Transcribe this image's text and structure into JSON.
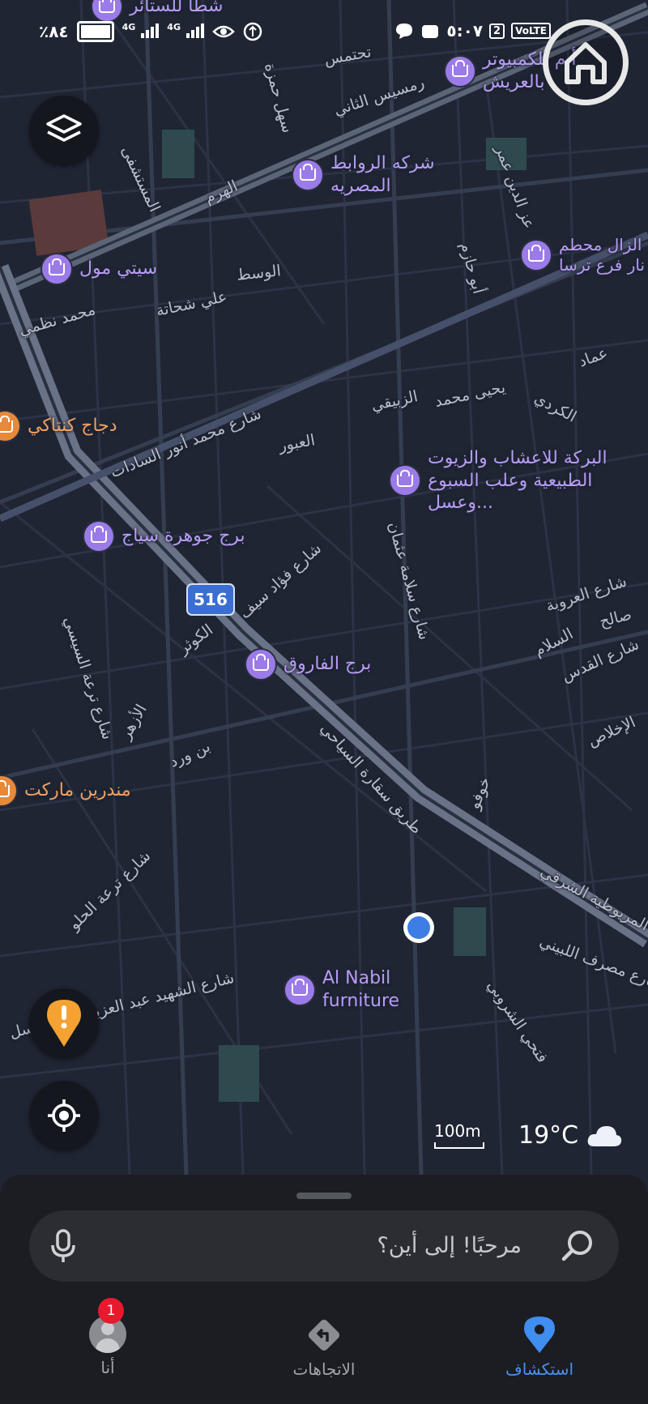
{
  "status_bar": {
    "battery_percent": "٪٨٤",
    "network_1": "4G",
    "network_2": "4G",
    "time": "٥:٠٧",
    "sim_badge": "2",
    "volte_label": "VoLTE"
  },
  "map": {
    "highway_shield": "516",
    "street_labels": [
      "تحتمس",
      "رمسيس الثاني",
      "سهل حمزة",
      "الهرم",
      "المستشفى",
      "الوسط",
      "علي شحاتة",
      "محمد نظمي",
      "أبو حازم",
      "عز الدين عمر",
      "عماد",
      "يحيى محمد",
      "الزبيقي",
      "الكردي",
      "شارع محمد أنور السادات",
      "العبور",
      "شارع فؤاد سيف",
      "شارع سلامة عثمان",
      "شارع العروبة",
      "صالح",
      "السلام",
      "شارع القدس",
      "الكوثر",
      "شارع ترعة السيسي",
      "الأزهر",
      "بن ورد",
      "طريق سقارة السياحي",
      "خوفو",
      "الإخلاص",
      "شارع ترعة الحلو",
      "المريوطية الشرقي",
      "شارع مصرف اللبيني",
      "شارع الشهيد عبد العزيز على الباسل",
      "فتحي الشروبي"
    ],
    "pois": [
      {
        "name": "شطا للستائر",
        "color": "purple"
      },
      {
        "name": "أ.م للكمبيوتر بالعريش",
        "color": "purple"
      },
      {
        "name": "شركه الروابط المصريه",
        "color": "purple"
      },
      {
        "name": "سيتي مول",
        "color": "purple"
      },
      {
        "name": "الزال محطم نار فرع ترسا",
        "color": "purple"
      },
      {
        "name": "دجاج كنتاكي",
        "color": "orange"
      },
      {
        "name": "البركة للاعشاب والزيوت الطبيعية وعلب السبوع وعسل...",
        "color": "purple"
      },
      {
        "name": "برج جوهرة سياج",
        "color": "purple"
      },
      {
        "name": "برج الفاروق",
        "color": "purple"
      },
      {
        "name": "مندرين ماركت",
        "color": "orange"
      },
      {
        "name": "Al Nabil furniture",
        "color": "purple"
      }
    ]
  },
  "scale": "100m",
  "weather": {
    "temperature": "19°C",
    "icon": "cloud-icon"
  },
  "search": {
    "placeholder": "مرحبًا! إلى أين؟"
  },
  "bottom_nav": {
    "me_label": "أنا",
    "me_badge": "1",
    "directions_label": "الاتجاهات",
    "explore_label": "استكشاف"
  },
  "colors": {
    "map_background": "#1f2533",
    "poi_purple": "#b79cf5",
    "poi_orange": "#f0a060",
    "accent_blue": "#4a90f0",
    "badge_red": "#e8192c"
  }
}
